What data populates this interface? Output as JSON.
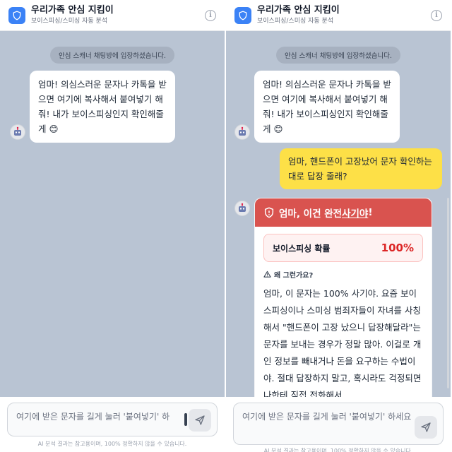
{
  "app": {
    "title": "우리가족 안심 지킴이",
    "subtitle": "보이스피싱/스미싱 자동 분석"
  },
  "system_message": "안심 스캐너 채팅방에 입장하셨습니다.",
  "left": {
    "bot_greeting": "엄마! 의심스러운 문자나 카톡을 받으면 여기에 복사해서 붙여넣기 해줘! 내가 보이스피싱인지 확인해줄게 😊",
    "input_placeholder": "여기에 받은 문자를 길게 눌러 '붙여넣기' 하"
  },
  "right": {
    "bot_greeting": "엄마! 의심스러운 문자나 카톡을 받으면 여기에 복사해서 붙여넣기 해줘! 내가 보이스피싱인지 확인해줄게 😊",
    "user_message": "엄마, 핸드폰이 고장났어 문자 확인하는대로 답장 줄래?",
    "result": {
      "headline_prefix": "엄마, 이건 완전 ",
      "headline_emphasis": "사기야",
      "headline_suffix": "!",
      "probability_label": "보이스피싱 확률",
      "probability_value": "100%",
      "probability": 1.0,
      "why_label": "왜 그런가요?",
      "why_body": "엄마, 이 문자는 100% 사기야. 요즘 보이스피싱이나 스미싱 범죄자들이 자녀를 사칭해서 \"핸드폰이 고장 났으니 답장해달라\"는 문자를 보내는 경우가 정말 많아. 이걸로 개인 정보를 빼내거나 돈을 요구하는 수법이야. 절대 답장하지 말고, 혹시라도 걱정되면 나한테 직접 전화해서"
    },
    "input_placeholder": "여기에 받은 문자를 길게 눌러 '붙여넣기' 하세요"
  },
  "disclaimer": "AI 분석 결과는 참고용이며, 100% 정확하지 않을 수 있습니다.",
  "colors": {
    "accent": "#3b82f6",
    "danger": "#d9534f",
    "user_bubble": "#fde047",
    "chat_bg": "#b9c4d3"
  },
  "icons": [
    "shield-icon",
    "info-icon",
    "robot-avatar-icon",
    "warning-shield-icon",
    "warning-triangle-icon",
    "send-icon"
  ]
}
